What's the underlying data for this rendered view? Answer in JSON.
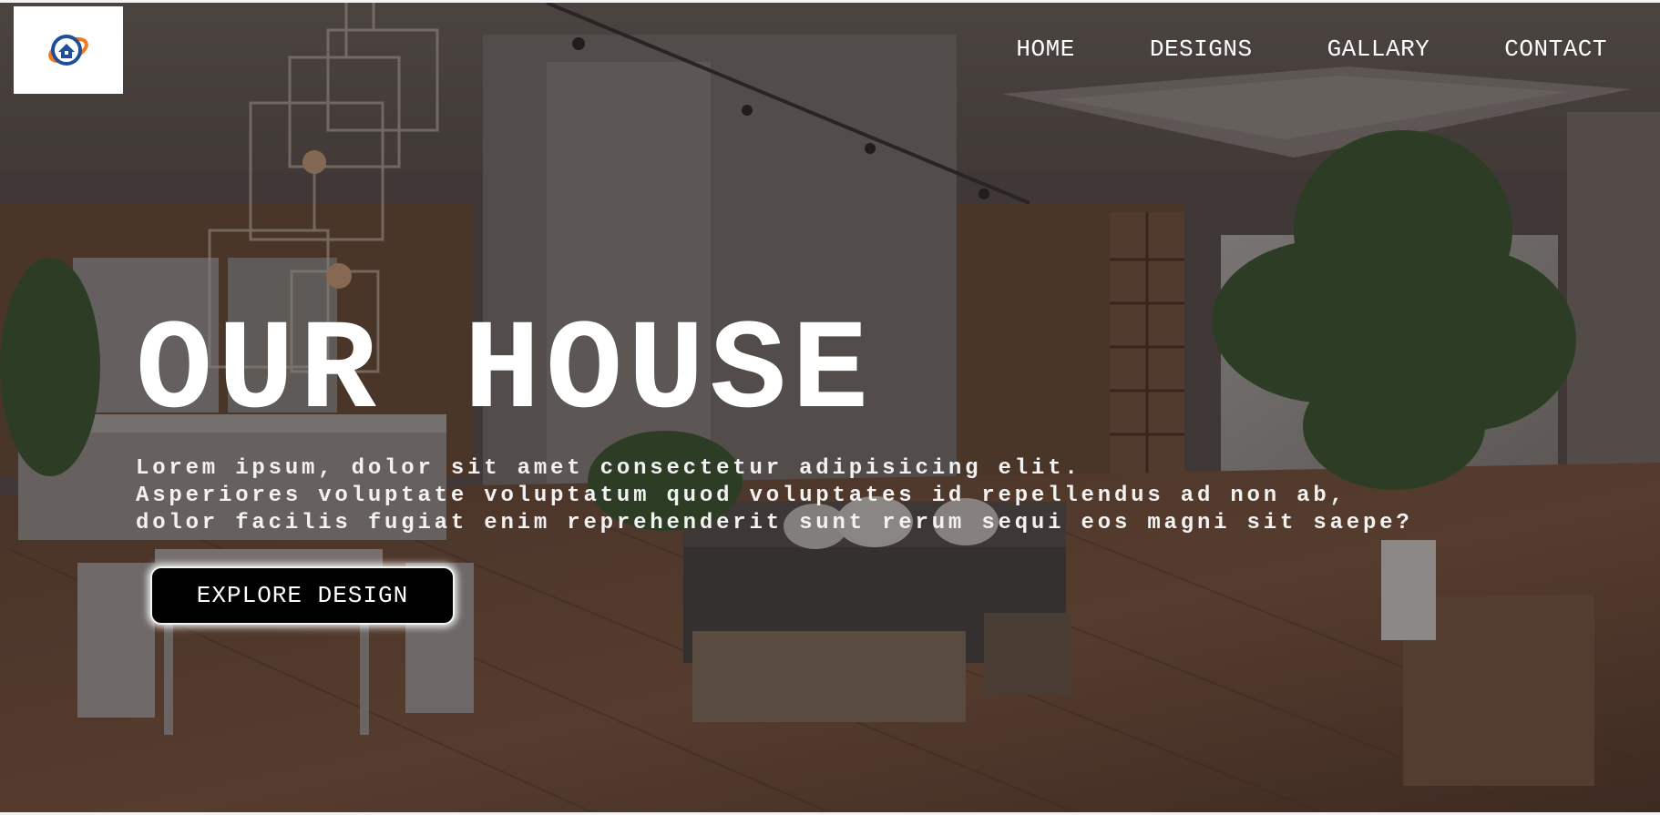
{
  "logo": {
    "icon": "house-globe-icon",
    "colors": {
      "primary": "#1f4f9c",
      "accent": "#f07b1f"
    }
  },
  "nav": {
    "items": [
      {
        "label": "HOME"
      },
      {
        "label": "DESIGNS"
      },
      {
        "label": "GALLARY"
      },
      {
        "label": "CONTACT"
      }
    ]
  },
  "hero": {
    "title": "OUR HOUSE",
    "description_lines": [
      "Lorem ipsum, dolor sit amet consectetur adipisicing elit.",
      "Asperiores voluptate voluptatum quod voluptates id repellendus ad non ab,",
      "dolor facilis fugiat enim reprehenderit sunt rerum sequi eos magni sit saepe?"
    ],
    "button_label": "EXPLORE DESIGN"
  },
  "colors": {
    "overlay": "#0f0e0e",
    "text": "#ffffff",
    "button_bg": "#000000"
  }
}
